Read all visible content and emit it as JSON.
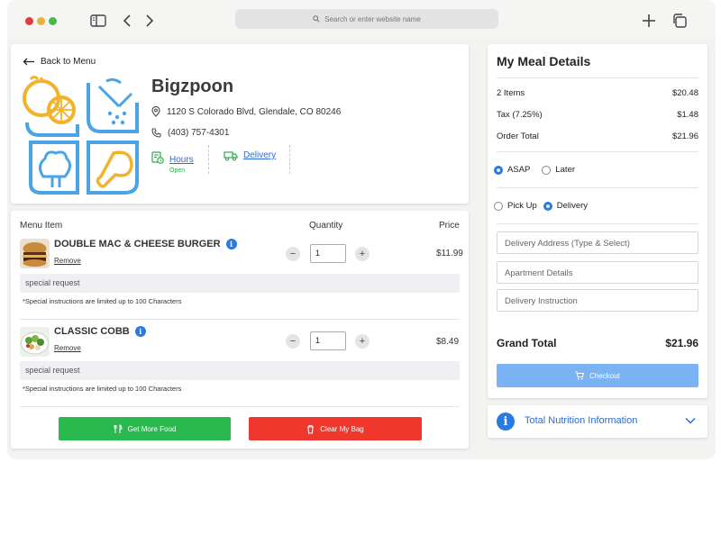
{
  "browser": {
    "address_placeholder": "Search or enter website name"
  },
  "restaurant": {
    "back_label": "Back to Menu",
    "name": "Bigzpoon",
    "address": "1120 S Colorado Blvd, Glendale, CO 80246",
    "phone": "(403) 757-4301",
    "hours_label": "Hours",
    "hours_status": "Open",
    "delivery_label": "Delivery"
  },
  "items": {
    "headers": {
      "item": "Menu Item",
      "quantity": "Quantity",
      "price": "Price"
    },
    "list": [
      {
        "name": "DOUBLE MAC & CHEESE BURGER",
        "remove": "Remove",
        "quantity": "1",
        "price": "$11.99",
        "special_placeholder": "special request",
        "note": "*Special instructions are limited up to 100 Characters"
      },
      {
        "name": "CLASSIC COBB",
        "remove": "Remove",
        "quantity": "1",
        "price": "$8.49",
        "special_placeholder": "special request",
        "note": "*Special instructions are limited up to 100 Characters"
      }
    ],
    "get_more_label": "Get More Food",
    "clear_label": "Clear My Bag"
  },
  "meal": {
    "title": "My Meal Details",
    "rows": [
      {
        "label": "2 Items",
        "value": "$20.48"
      },
      {
        "label": "Tax (7.25%)",
        "value": "$1.48"
      },
      {
        "label": "Order Total",
        "value": "$21.96"
      }
    ],
    "timing": {
      "asap": "ASAP",
      "later": "Later",
      "selected": "asap"
    },
    "method": {
      "pickup": "Pick Up",
      "delivery": "Delivery",
      "selected": "delivery"
    },
    "delivery_address_placeholder": "Delivery Address (Type & Select)",
    "apartment_placeholder": "Apartment Details",
    "instruction_placeholder": "Delivery Instruction",
    "grand_label": "Grand Total",
    "grand_value": "$21.96",
    "checkout_label": "Checkout"
  },
  "nutrition": {
    "label": "Total Nutrition Information"
  },
  "colors": {
    "accent_blue": "#2a7ae2",
    "green": "#2ab94f",
    "red": "#f0372e",
    "checkout": "#7ab2f4"
  }
}
